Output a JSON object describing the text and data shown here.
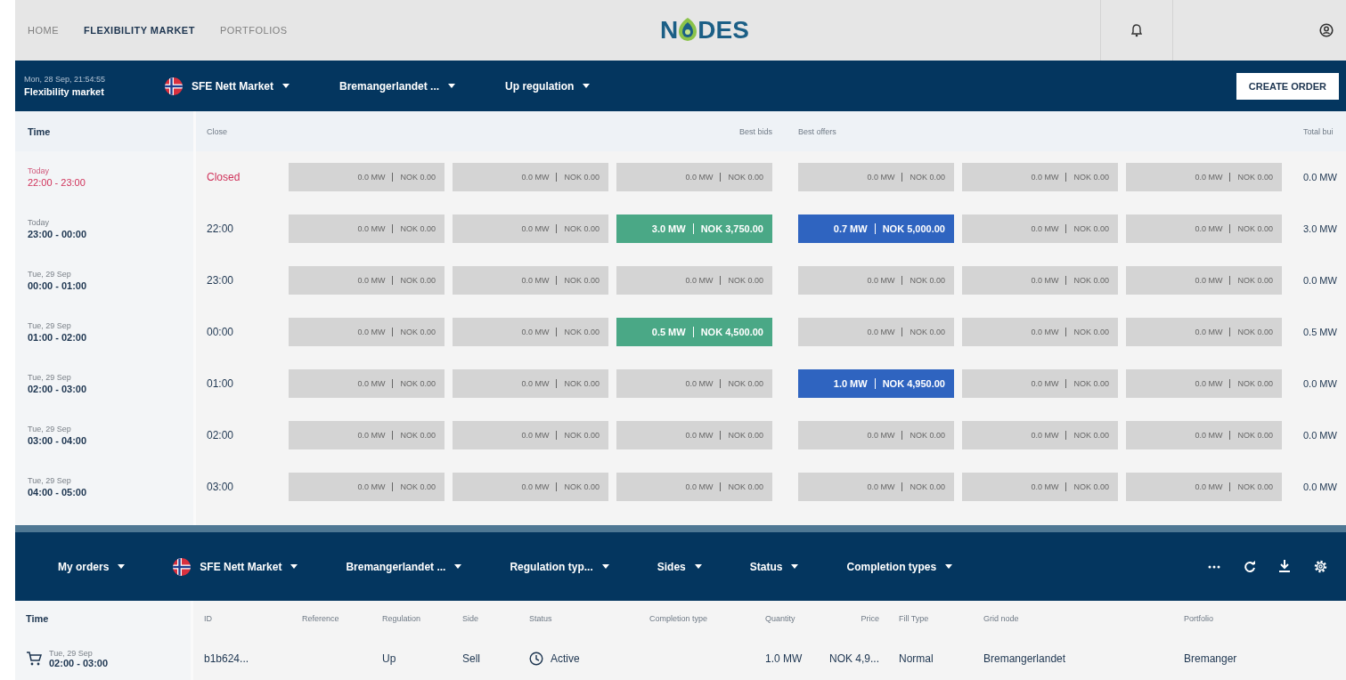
{
  "nav": {
    "links": [
      {
        "label": "HOME",
        "selected": false
      },
      {
        "label": "FLEXIBILITY MARKET",
        "selected": true
      },
      {
        "label": "PORTFOLIOS",
        "selected": false
      }
    ],
    "logo": {
      "before": "N",
      "after": "DES"
    }
  },
  "market_bar": {
    "timestamp": "Mon, 28 Sep, 21:54:55",
    "title": "Flexibility market",
    "filters": [
      {
        "label": "SFE Nett Market",
        "flag": true
      },
      {
        "label": "Bremangerlandet ...",
        "flag": false
      },
      {
        "label": "Up regulation",
        "flag": false
      }
    ],
    "create_button": "CREATE ORDER"
  },
  "market_table": {
    "columns": {
      "time": "Time",
      "close": "Close",
      "bids": "Best bids",
      "offers": "Best offers",
      "total": "Total bui"
    },
    "rows": [
      {
        "day": "Today",
        "time": "22:00 - 23:00",
        "close": "Closed",
        "closed": true,
        "total": "0.0 MW",
        "cells": [
          {
            "kind": "empty",
            "qty": "0.0 MW",
            "price": "NOK 0.00"
          },
          {
            "kind": "empty",
            "qty": "0.0 MW",
            "price": "NOK 0.00"
          },
          {
            "kind": "empty",
            "qty": "0.0 MW",
            "price": "NOK 0.00"
          },
          {
            "kind": "empty",
            "qty": "0.0 MW",
            "price": "NOK 0.00"
          },
          {
            "kind": "empty",
            "qty": "0.0 MW",
            "price": "NOK 0.00"
          },
          {
            "kind": "empty",
            "qty": "0.0 MW",
            "price": "NOK 0.00"
          }
        ]
      },
      {
        "day": "Today",
        "time": "23:00 - 00:00",
        "close": "22:00",
        "closed": false,
        "total": "3.0 MW",
        "cells": [
          {
            "kind": "empty",
            "qty": "0.0 MW",
            "price": "NOK 0.00"
          },
          {
            "kind": "empty",
            "qty": "0.0 MW",
            "price": "NOK 0.00"
          },
          {
            "kind": "bid",
            "qty": "3.0 MW",
            "price": "NOK 3,750.00"
          },
          {
            "kind": "offer",
            "qty": "0.7 MW",
            "price": "NOK 5,000.00"
          },
          {
            "kind": "empty",
            "qty": "0.0 MW",
            "price": "NOK 0.00"
          },
          {
            "kind": "empty",
            "qty": "0.0 MW",
            "price": "NOK 0.00"
          }
        ]
      },
      {
        "day": "Tue, 29 Sep",
        "time": "00:00 - 01:00",
        "close": "23:00",
        "closed": false,
        "total": "0.0 MW",
        "cells": [
          {
            "kind": "empty",
            "qty": "0.0 MW",
            "price": "NOK 0.00"
          },
          {
            "kind": "empty",
            "qty": "0.0 MW",
            "price": "NOK 0.00"
          },
          {
            "kind": "empty",
            "qty": "0.0 MW",
            "price": "NOK 0.00"
          },
          {
            "kind": "empty",
            "qty": "0.0 MW",
            "price": "NOK 0.00"
          },
          {
            "kind": "empty",
            "qty": "0.0 MW",
            "price": "NOK 0.00"
          },
          {
            "kind": "empty",
            "qty": "0.0 MW",
            "price": "NOK 0.00"
          }
        ]
      },
      {
        "day": "Tue, 29 Sep",
        "time": "01:00 - 02:00",
        "close": "00:00",
        "closed": false,
        "total": "0.5 MW",
        "cells": [
          {
            "kind": "empty",
            "qty": "0.0 MW",
            "price": "NOK 0.00"
          },
          {
            "kind": "empty",
            "qty": "0.0 MW",
            "price": "NOK 0.00"
          },
          {
            "kind": "bid",
            "qty": "0.5 MW",
            "price": "NOK 4,500.00"
          },
          {
            "kind": "empty",
            "qty": "0.0 MW",
            "price": "NOK 0.00"
          },
          {
            "kind": "empty",
            "qty": "0.0 MW",
            "price": "NOK 0.00"
          },
          {
            "kind": "empty",
            "qty": "0.0 MW",
            "price": "NOK 0.00"
          }
        ]
      },
      {
        "day": "Tue, 29 Sep",
        "time": "02:00 - 03:00",
        "close": "01:00",
        "closed": false,
        "total": "0.0 MW",
        "cells": [
          {
            "kind": "empty",
            "qty": "0.0 MW",
            "price": "NOK 0.00"
          },
          {
            "kind": "empty",
            "qty": "0.0 MW",
            "price": "NOK 0.00"
          },
          {
            "kind": "empty",
            "qty": "0.0 MW",
            "price": "NOK 0.00"
          },
          {
            "kind": "offer",
            "qty": "1.0 MW",
            "price": "NOK 4,950.00"
          },
          {
            "kind": "empty",
            "qty": "0.0 MW",
            "price": "NOK 0.00"
          },
          {
            "kind": "empty",
            "qty": "0.0 MW",
            "price": "NOK 0.00"
          }
        ]
      },
      {
        "day": "Tue, 29 Sep",
        "time": "03:00 - 04:00",
        "close": "02:00",
        "closed": false,
        "total": "0.0 MW",
        "cells": [
          {
            "kind": "empty",
            "qty": "0.0 MW",
            "price": "NOK 0.00"
          },
          {
            "kind": "empty",
            "qty": "0.0 MW",
            "price": "NOK 0.00"
          },
          {
            "kind": "empty",
            "qty": "0.0 MW",
            "price": "NOK 0.00"
          },
          {
            "kind": "empty",
            "qty": "0.0 MW",
            "price": "NOK 0.00"
          },
          {
            "kind": "empty",
            "qty": "0.0 MW",
            "price": "NOK 0.00"
          },
          {
            "kind": "empty",
            "qty": "0.0 MW",
            "price": "NOK 0.00"
          }
        ]
      },
      {
        "day": "Tue, 29 Sep",
        "time": "04:00 - 05:00",
        "close": "03:00",
        "closed": false,
        "total": "0.0 MW",
        "cells": [
          {
            "kind": "empty",
            "qty": "0.0 MW",
            "price": "NOK 0.00"
          },
          {
            "kind": "empty",
            "qty": "0.0 MW",
            "price": "NOK 0.00"
          },
          {
            "kind": "empty",
            "qty": "0.0 MW",
            "price": "NOK 0.00"
          },
          {
            "kind": "empty",
            "qty": "0.0 MW",
            "price": "NOK 0.00"
          },
          {
            "kind": "empty",
            "qty": "0.0 MW",
            "price": "NOK 0.00"
          },
          {
            "kind": "empty",
            "qty": "0.0 MW",
            "price": "NOK 0.00"
          }
        ]
      }
    ]
  },
  "orders_bar": {
    "filters": [
      {
        "label": "My orders",
        "flag": false
      },
      {
        "label": "SFE Nett Market",
        "flag": true
      },
      {
        "label": "Bremangerlandet ...",
        "flag": false
      },
      {
        "label": "Regulation typ...",
        "flag": false
      },
      {
        "label": "Sides",
        "flag": false
      },
      {
        "label": "Status",
        "flag": false
      },
      {
        "label": "Completion types",
        "flag": false
      }
    ]
  },
  "orders_table": {
    "columns": [
      "Time",
      "ID",
      "Reference",
      "Regulation",
      "Side",
      "Status",
      "Completion type",
      "Quantity",
      "Price",
      "Fill Type",
      "Grid node",
      "Portfolio"
    ],
    "rows": [
      {
        "day": "Tue, 29 Sep",
        "time": "02:00 - 03:00",
        "id": "b1b624...",
        "regulation": "Up",
        "side": "Sell",
        "status": "Active",
        "quantity": "1.0 MW",
        "price": "NOK 4,9...",
        "fill_type": "Normal",
        "grid_node": "Bremangerlandet",
        "portfolio": "Bremanger"
      }
    ]
  }
}
